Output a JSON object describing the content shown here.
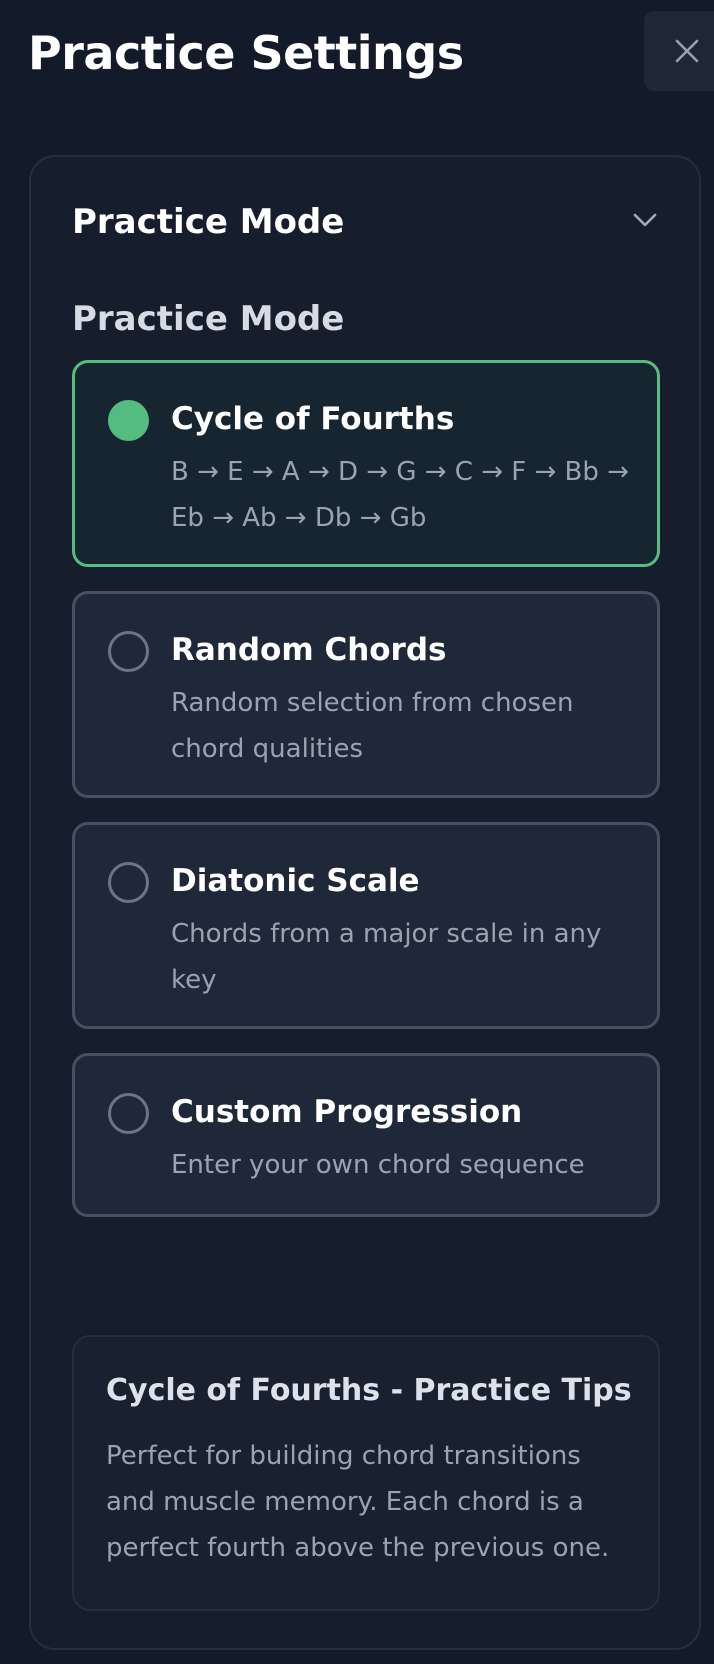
{
  "header": {
    "title": "Practice Settings",
    "close_icon": "close-icon"
  },
  "section": {
    "title": "Practice Mode",
    "chevron_icon": "chevron-down-icon",
    "expanded": true
  },
  "practice_mode": {
    "label": "Practice Mode",
    "selected": "Cycle of Fourths",
    "options": [
      {
        "title": "Cycle of Fourths",
        "description": "B → E → A → D → G → C → F → Bb → Eb → Ab → Db → Gb",
        "selected": true
      },
      {
        "title": "Random Chords",
        "description": "Random selection from chosen chord qualities",
        "selected": false
      },
      {
        "title": "Diatonic Scale",
        "description": "Chords from a major scale in any key",
        "selected": false
      },
      {
        "title": "Custom Progression",
        "description": "Enter your own chord sequence",
        "selected": false
      }
    ]
  },
  "tips": {
    "title": "Cycle of Fourths - Practice Tips",
    "body": "Perfect for building chord transitions and muscle memory. Each chord is a perfect fourth above the previous one."
  },
  "colors": {
    "background": "#131a2a",
    "selected_accent": "#54bc7f",
    "card_background": "#1f2838",
    "card_border": "#465062"
  }
}
